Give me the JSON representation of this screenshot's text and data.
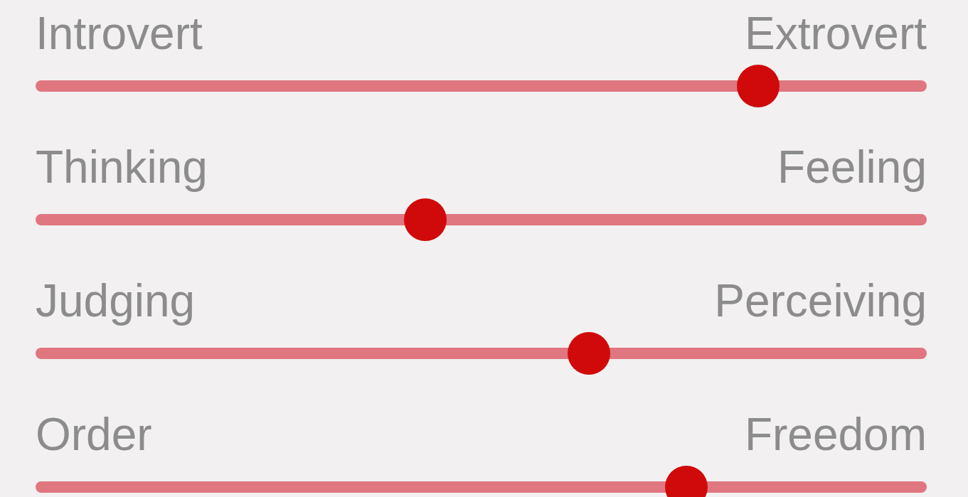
{
  "sliders": [
    {
      "left_label": "Introvert",
      "right_label": "Extrovert",
      "level": 0.811
    },
    {
      "left_label": "Thinking",
      "right_label": "Feeling",
      "level": 0.437
    },
    {
      "left_label": "Judging",
      "right_label": "Perceiving",
      "level": 0.621
    },
    {
      "left_label": "Order",
      "right_label": "Freedom",
      "level": 0.73
    }
  ]
}
